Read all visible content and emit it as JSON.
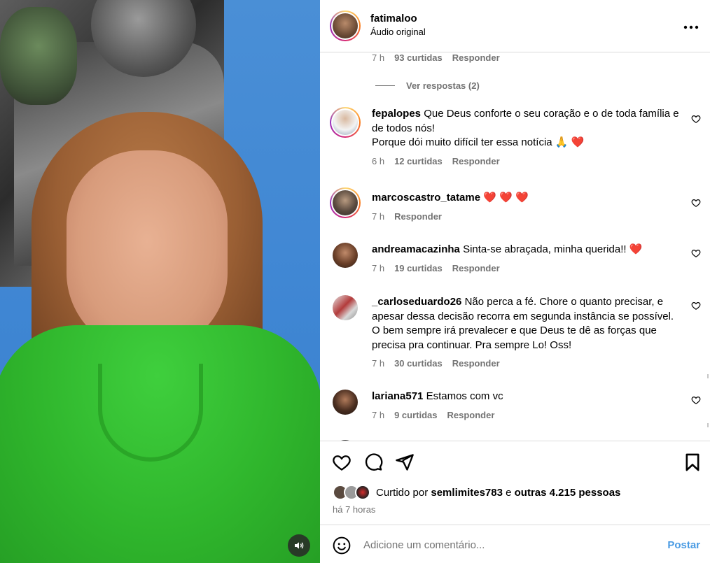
{
  "post": {
    "username": "fatimaloo",
    "audio_label": "Áudio original",
    "more_icon": "more-horizontal-icon"
  },
  "top_reply_meta": {
    "time": "7 h",
    "likes": "93 curtidas",
    "reply": "Responder"
  },
  "view_replies": "Ver respostas (2)",
  "comments": [
    {
      "username": "fepalopes",
      "text": "Que Deus conforte o seu coração e o de toda família e de todos nós!\nPorque dói muito difícil ter essa notícia 🙏 ❤️",
      "time": "6 h",
      "likes": "12 curtidas",
      "reply": "Responder"
    },
    {
      "username": "marcoscastro_tatame",
      "text": "❤️ ❤️ ❤️",
      "time": "7 h",
      "likes": "",
      "reply": "Responder"
    },
    {
      "username": "andreamacazinha",
      "text": "Sinta-se abraçada, minha querida!! ❤️",
      "time": "7 h",
      "likes": "19 curtidas",
      "reply": "Responder"
    },
    {
      "username": "_carloseduardo26",
      "text": "Não perca a fé. Chore o quanto precisar, e apesar dessa decisão recorra em segunda instância se possível. O bem sempre irá prevalecer e que Deus te dê as forças que precisa pra continuar. Pra sempre Lo! Oss!",
      "time": "7 h",
      "likes": "30 curtidas",
      "reply": "Responder"
    },
    {
      "username": "lariana571",
      "text": "Estamos com vc",
      "time": "7 h",
      "likes": "9 curtidas",
      "reply": "Responder"
    }
  ],
  "likes": {
    "prefix": "Curtido por",
    "user": "semlimites783",
    "joiner": "e",
    "others": "outras 4.215 pessoas"
  },
  "time_ago": "há 7 horas",
  "composer": {
    "placeholder": "Adicione um comentário...",
    "post_label": "Postar"
  },
  "colors": {
    "accent_blue": "#4a9be3",
    "muted_text": "#737373",
    "divider": "#dbdbdb",
    "shirt_green": "#2fb52c"
  }
}
